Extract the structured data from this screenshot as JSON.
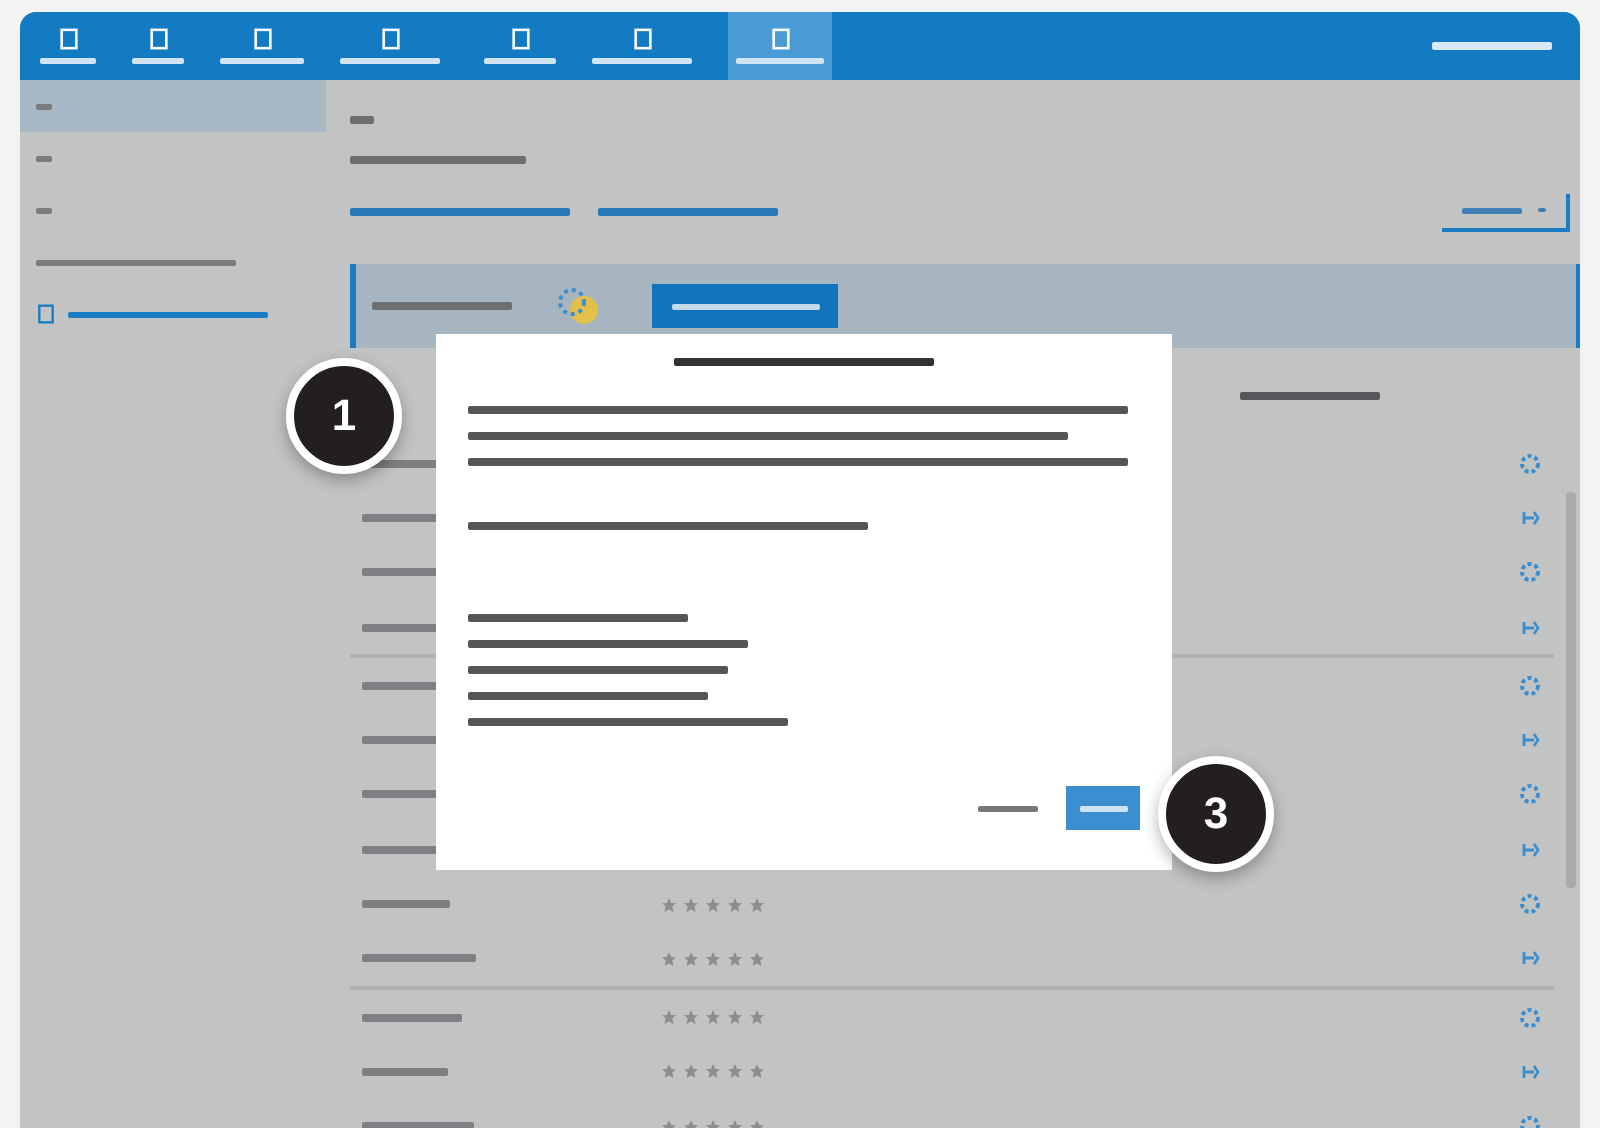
{
  "header": {
    "tabs": [
      {
        "selected": false
      },
      {
        "selected": false
      },
      {
        "selected": false
      },
      {
        "selected": false
      },
      {
        "selected": false
      },
      {
        "selected": false
      },
      {
        "selected": true
      }
    ]
  },
  "sidebar": {
    "items": [
      {
        "selected": true
      },
      {
        "selected": false
      },
      {
        "selected": false
      },
      {
        "selected": false
      },
      {
        "selected": false
      }
    ]
  },
  "table": {
    "groups": [
      [
        {
          "kind": "plain"
        },
        {
          "kind": "plain"
        },
        {
          "kind": "plain"
        },
        {
          "kind": "plain"
        }
      ],
      [
        {
          "kind": "plain"
        },
        {
          "kind": "plain"
        },
        {
          "kind": "plain"
        },
        {
          "kind": "plain"
        },
        {
          "kind": "rated",
          "stars": 0
        },
        {
          "kind": "rated",
          "stars": 0
        }
      ],
      [
        {
          "kind": "rated",
          "stars": 0
        },
        {
          "kind": "rated",
          "stars": 0
        },
        {
          "kind": "rated",
          "stars": 0
        }
      ]
    ]
  },
  "callouts": [
    "1",
    "3"
  ]
}
